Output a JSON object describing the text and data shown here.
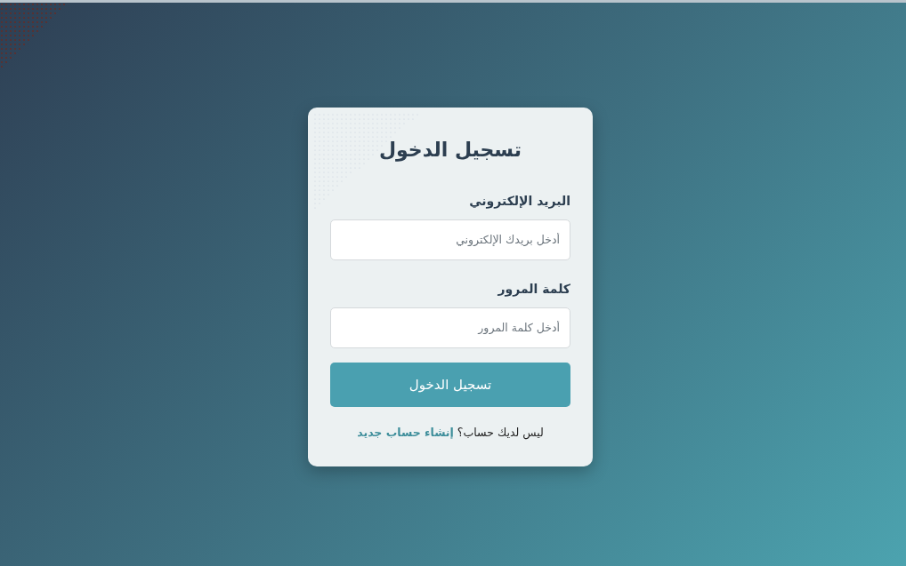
{
  "title": "تسجيل الدخول",
  "fields": [
    {
      "label": "البريد الإلكتروني",
      "placeholder": "أدخل بريدك الإلكتروني"
    },
    {
      "label": "كلمة المرور",
      "placeholder": "أدخل كلمة المرور"
    }
  ],
  "submit": "تسجيل الدخول",
  "signup": {
    "text": "ليس لديك حساب؟",
    "link": "إنشاء حساب جديد"
  }
}
